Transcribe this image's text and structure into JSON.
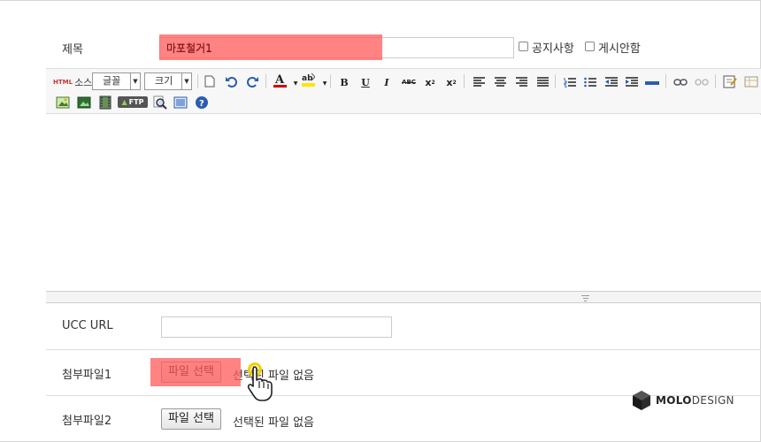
{
  "form": {
    "title_label": "제목",
    "title_value": "마포철거1",
    "notice_label": "공지사항",
    "hide_label": "게시안함",
    "ucc_label": "UCC URL",
    "ucc_value": "",
    "attach1_label": "첨부파일1",
    "attach2_label": "첨부파일2",
    "file_button_label": "파일 선택",
    "no_file_text": "선택된 파일 없음"
  },
  "toolbar": {
    "html_label": "HTML",
    "source_label": "소스",
    "font_label": "글꼴",
    "size_label": "크기",
    "ftp_label": "FTP",
    "font_color": "#d40000",
    "highlight_color": "#ffe600",
    "icons": [
      "new-document-icon",
      "undo-icon",
      "redo-icon",
      "font-color-icon",
      "highlight-icon",
      "bold-icon",
      "underline-icon",
      "italic-icon",
      "strikethrough-icon",
      "superscript-icon",
      "subscript-icon",
      "align-left-icon",
      "align-center-icon",
      "align-right-icon",
      "justify-icon",
      "ordered-list-icon",
      "unordered-list-icon",
      "outdent-icon",
      "indent-icon",
      "horizontal-rule-icon",
      "link-icon",
      "unlink-icon",
      "edit-icon",
      "table-icon",
      "image-icon",
      "image-upload-icon",
      "media-icon",
      "ftp-icon",
      "search-icon",
      "layout-icon",
      "help-icon"
    ]
  },
  "brand": {
    "bold": "MOLO",
    "rest": "DESIGN"
  },
  "colors": {
    "highlight_overlay": "#ff5a5a",
    "cursor_ring": "#f1d000"
  }
}
